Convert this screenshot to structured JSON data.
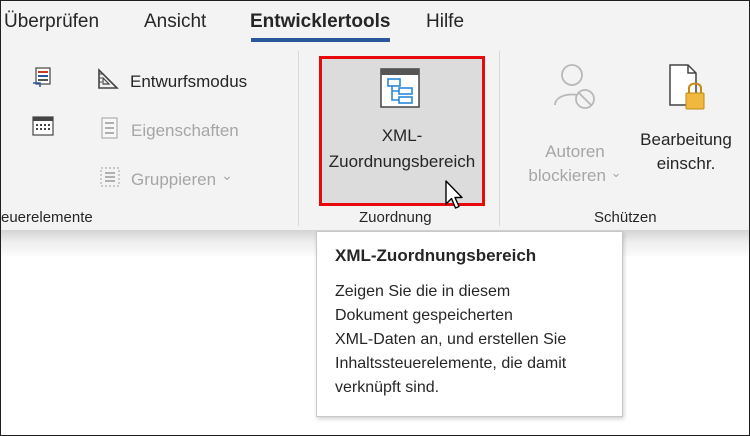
{
  "tabs": [
    {
      "label": "Überprüfen"
    },
    {
      "label": "Ansicht"
    },
    {
      "label": "Entwicklertools",
      "active": true
    },
    {
      "label": "Hilfe"
    }
  ],
  "groups": {
    "steuerelemente": {
      "label": "euerelemente",
      "design_mode": "Entwurfsmodus",
      "properties": "Eigenschaften",
      "group": "Gruppieren",
      "group_chevron": "⌄"
    },
    "zuordnung": {
      "label": "Zuordnung",
      "xml_line1": "XML-",
      "xml_line2": "Zuordnungsbereich"
    },
    "schuetzen": {
      "label": "Schützen",
      "block_line1": "Autoren",
      "block_line2": "blockieren",
      "block_chevron": "⌄",
      "restrict_line1": "Bearbeitung",
      "restrict_line2": "einschr."
    }
  },
  "tooltip": {
    "title": "XML-Zuordnungsbereich",
    "lines": [
      "Zeigen Sie die in diesem",
      "Dokument gespeicherten",
      "XML-Daten an, und erstellen Sie",
      "Inhaltssteuerelemente, die damit",
      "verknüpft sind."
    ]
  },
  "colors": {
    "active_tab_underline": "#2b579a",
    "highlight_border": "#e8090d",
    "disabled_text": "#a6a6a6",
    "ribbon_bg": "#f3f3f3"
  },
  "icons": [
    "legacy-tools-icon",
    "date-picker-icon",
    "design-mode-icon",
    "properties-icon",
    "group-icon",
    "xml-mapping-pane-icon",
    "block-authors-icon",
    "restrict-editing-icon",
    "mouse-cursor-icon"
  ]
}
